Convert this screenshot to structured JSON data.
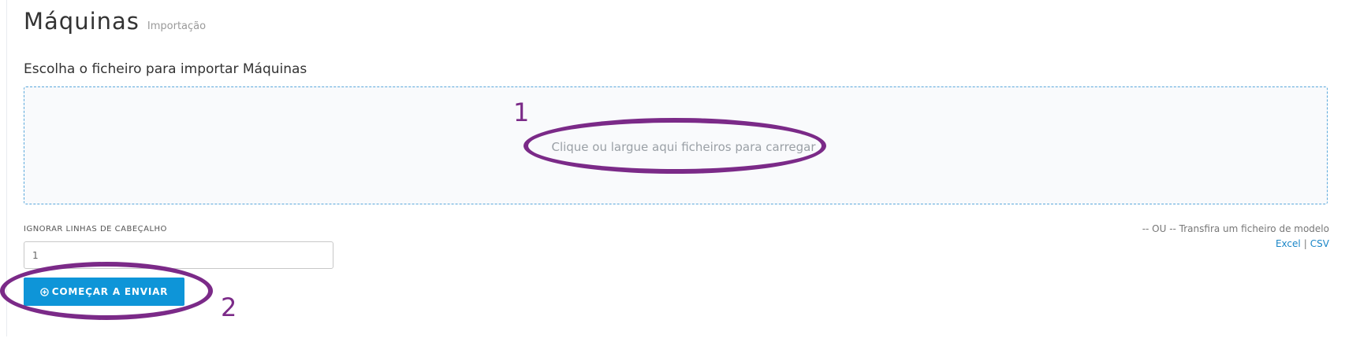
{
  "header": {
    "title": "Máquinas",
    "subtitle": "Importação"
  },
  "upload": {
    "section_label": "Escolha o ficheiro para importar Máquinas",
    "dropzone_text": "Clique ou largue aqui ficheiros para carregar"
  },
  "form": {
    "header_rows_label": "IGNORAR LINHAS DE CABEÇALHO",
    "header_rows_value": "1",
    "start_button_label": "COMEÇAR A ENVIAR"
  },
  "template": {
    "prompt": "-- OU -- Transfira um ficheiro de modelo",
    "excel_label": "Excel",
    "separator": "|",
    "csv_label": "CSV"
  },
  "annotations": {
    "marker_1": "1",
    "marker_2": "2",
    "color": "#7b2a88"
  },
  "colors": {
    "primary_button": "#0e95d8",
    "link": "#1a86c7",
    "dropzone_border": "#5aa8db"
  },
  "icons": {
    "start_button_icon": "plus-circle-icon"
  }
}
